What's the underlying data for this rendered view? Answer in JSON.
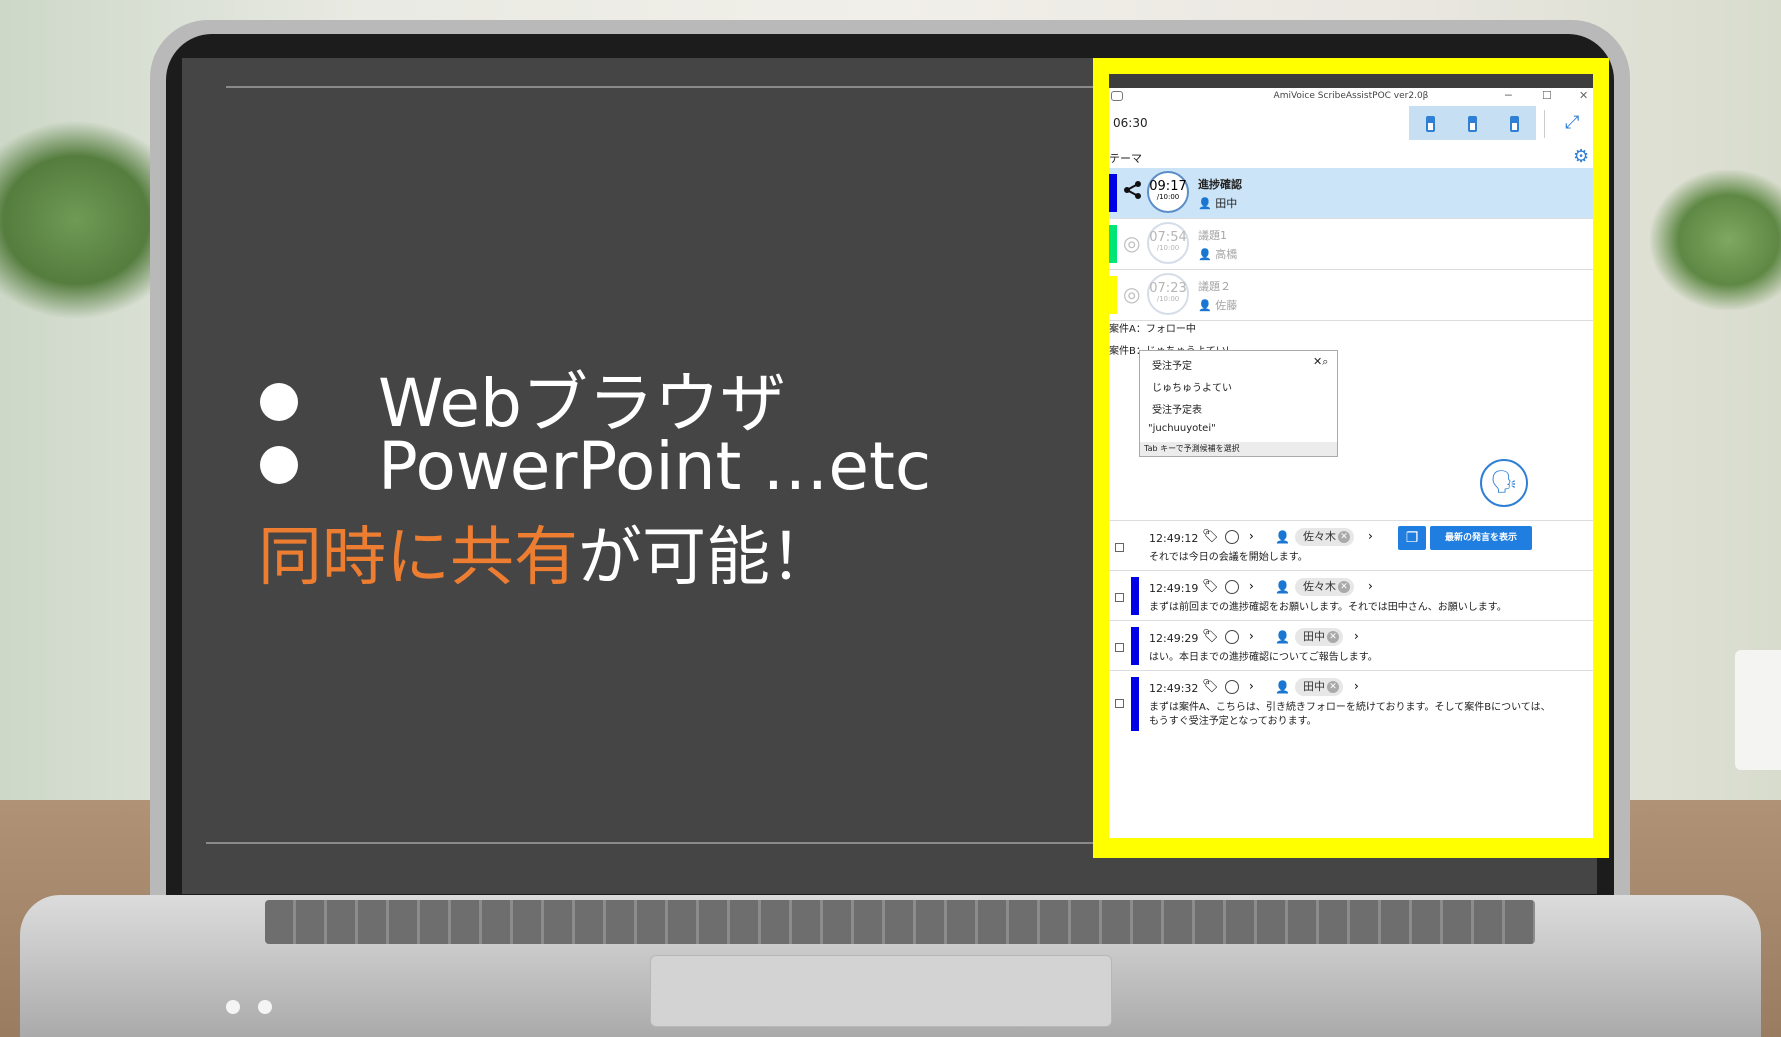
{
  "slide": {
    "bullets": [
      "Webブラウザ",
      "PowerPoint …etc"
    ],
    "tagline_highlight": "同時に共有",
    "tagline_rest": "が可能！"
  },
  "app": {
    "window_title": "AmiVoice ScribeAssistPOC ver2.0β",
    "timer": "06:30",
    "theme_label": "テーマ",
    "agenda": [
      {
        "time": "09:17",
        "limit": "/10:00",
        "title": "進捗確認",
        "person": "田中",
        "color": "#0000e6",
        "state": "active"
      },
      {
        "time": "07:54",
        "limit": "/10:00",
        "title": "議題1",
        "person": "高橋",
        "color": "#00e676",
        "state": "done"
      },
      {
        "time": "07:23",
        "limit": "/10:00",
        "title": "議題２",
        "person": "佐藤",
        "color": "#ffff00",
        "state": "done"
      }
    ],
    "editor": {
      "line1": "案件A：フォロー中",
      "line2_prefix": "案件B：",
      "line2_composing": "じゅちゅうよてい"
    },
    "ime": {
      "candidates": [
        "受注予定",
        "じゅちゅうよてい",
        "受注予定表",
        "\"juchuuyotei\""
      ],
      "hint": "Tab キーで予測候補を選択"
    },
    "latest_button": "最新の発言を表示",
    "logs": [
      {
        "time": "12:49:12",
        "speaker": "佐々木",
        "text": "それでは今日の会議を開始します。"
      },
      {
        "time": "12:49:19",
        "speaker": "佐々木",
        "text": "まずは前回までの進捗確認をお願いします。それでは田中さん、お願いします。"
      },
      {
        "time": "12:49:29",
        "speaker": "田中",
        "text": "はい。本日までの進捗確認についてご報告します。"
      },
      {
        "time": "12:49:32",
        "speaker": "田中",
        "text": "まずは案件A、こちらは、引き続きフォローを続けております。そして案件Bについては、",
        "text2": "もうすぐ受注予定となっております。"
      }
    ],
    "icons": {
      "share": "share-icon",
      "check": "check-circle-icon",
      "person": "person-icon",
      "tag": "tag-icon",
      "mic": "speaker-icon",
      "gear": "gear-icon",
      "expand": "expand-icon",
      "copy": "copy-icon"
    },
    "colors": {
      "accent": "#1f7ee0",
      "highlight_frame": "#ffff00",
      "active_row": "#cce4f7"
    }
  }
}
